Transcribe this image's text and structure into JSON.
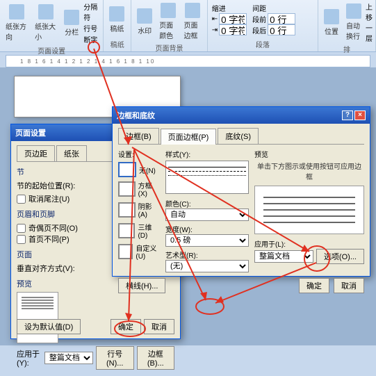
{
  "ribbon": {
    "groups": {
      "page_setup": {
        "label": "页面设置",
        "buttons": [
          "纸张方向",
          "纸张大小",
          "分栏"
        ],
        "small": [
          "分隔符",
          "行号",
          "断字"
        ]
      },
      "paper": {
        "label": "稿纸",
        "btn": "稿纸"
      },
      "background": {
        "label": "页面背景",
        "buttons": [
          "水印",
          "页面颜色",
          "页面边框"
        ]
      },
      "paragraph": {
        "label": "段落",
        "indent_label": "缩进",
        "spacing_label": "间距",
        "left_val": "0 字符",
        "right_val": "0 字符",
        "before_label": "段前",
        "before_val": "0 行",
        "after_label": "段后",
        "after_val": "0 行"
      },
      "arrange": {
        "position": "位置",
        "wrap": "自动换行",
        "forward": "上移一层",
        "label": "排"
      }
    }
  },
  "ruler": "1  8  1  6  1  4  1  2  1  2  1  4  1  6  1  8  1  10",
  "dlg_page_setup": {
    "title": "页面设置",
    "tabs": [
      "页边距",
      "纸张"
    ],
    "section": {
      "label": "节",
      "start": "节的起始位置(R):",
      "suppress": "取消尾注(U)"
    },
    "header_footer": {
      "label": "页眉和页脚",
      "odd_even": "奇偶页不同(O)",
      "first": "首页不同(P)"
    },
    "page": {
      "label": "页面",
      "valign": "垂直对齐方式(V):"
    },
    "preview_label": "预览",
    "apply_to_label": "应用于(Y):",
    "apply_to_val": "整篇文档",
    "line_num": "行号(N)...",
    "border": "边框(B)...",
    "default": "设为默认值(D)",
    "ok": "确定",
    "cancel": "取消"
  },
  "dlg_border": {
    "title": "边框和底纹",
    "tabs": [
      "边框(B)",
      "页面边框(P)",
      "底纹(S)"
    ],
    "setting_label": "设置:",
    "settings": [
      "无(N)",
      "方框(X)",
      "阴影(A)",
      "三维(D)",
      "自定义(U)"
    ],
    "style_label": "样式(Y):",
    "color_label": "颜色(C):",
    "color_val": "自动",
    "width_label": "宽度(W):",
    "width_val": "0.5 磅",
    "art_label": "艺术型(R):",
    "art_val": "(无)",
    "preview_label": "预览",
    "preview_hint": "单击下方图示或使用按钮可应用边框",
    "apply_to_label": "应用于(L):",
    "apply_to_val": "整篇文档",
    "options": "选项(O)...",
    "hline": "横线(H)...",
    "ok": "确定",
    "cancel": "取消"
  }
}
